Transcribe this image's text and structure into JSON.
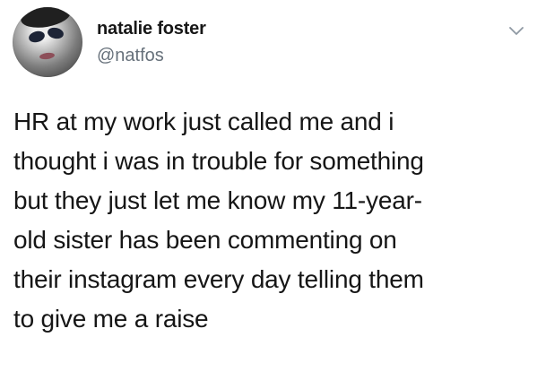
{
  "tweet": {
    "author": {
      "name": "natalie foster",
      "handle": "@natfos"
    },
    "text_lines": [
      "HR at my work just called me and i",
      "thought i was in trouble for something",
      "but they just let me know my 11-year-",
      "old sister has been commenting on",
      "their instagram every day telling them",
      "to give me a raise"
    ],
    "icons": {
      "avatar": "profile-avatar",
      "menu": "chevron-down-icon"
    },
    "colors": {
      "background": "#ffffff",
      "text": "#161616",
      "handle": "#66707a",
      "icon": "#8f99a3"
    }
  }
}
